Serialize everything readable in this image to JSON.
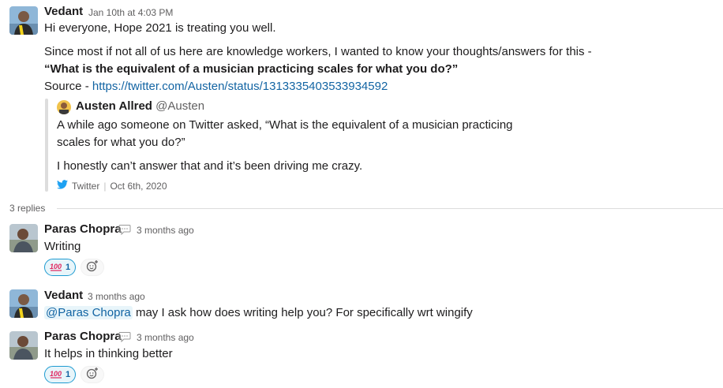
{
  "parent": {
    "author": "Vedant",
    "timestamp": "Jan 10th at 4:03 PM",
    "line1": "Hi everyone, Hope 2021 is treating you well.",
    "line2": "Since most if not all of us here are knowledge workers, I wanted to know your thoughts/answers for this -",
    "line3": "“What is the equivalent of a musician practicing scales for what you do?”",
    "source_label": "Source - ",
    "source_url": "https://twitter.com/Austen/status/1313335403533934592"
  },
  "quote": {
    "author": "Austen Allred",
    "handle": "@Austen",
    "text1": "A while ago someone on Twitter asked, “What is the equivalent of a musician practicing",
    "text2": "scales for what you do?”",
    "text3": "I honestly can’t answer that and it’s been driving me crazy.",
    "platform": "Twitter",
    "date": "Oct 6th, 2020"
  },
  "replies_label": "3 replies",
  "replies": [
    {
      "author": "Paras Chopra",
      "timestamp": "3 months ago",
      "text": "Writing",
      "reaction_emoji": "💯",
      "reaction_count": "1"
    },
    {
      "author": "Vedant",
      "timestamp": "3 months ago",
      "mention": "@Paras Chopra",
      "text": " may I ask how does writing help you? For specifically wrt wingify"
    },
    {
      "author": "Paras Chopra",
      "timestamp": "3 months ago",
      "text": "It helps in thinking better",
      "reaction_emoji": "💯",
      "reaction_count": "1"
    }
  ],
  "icons": {
    "status": "speech-bubble-icon",
    "twitter": "twitter-bird-icon",
    "add_reaction": "add-reaction-icon"
  },
  "colors": {
    "link": "#1264a3",
    "reaction_bg": "#e8f5fa",
    "reaction_border": "#1d9bd1",
    "twitter_blue": "#1da1f2"
  }
}
